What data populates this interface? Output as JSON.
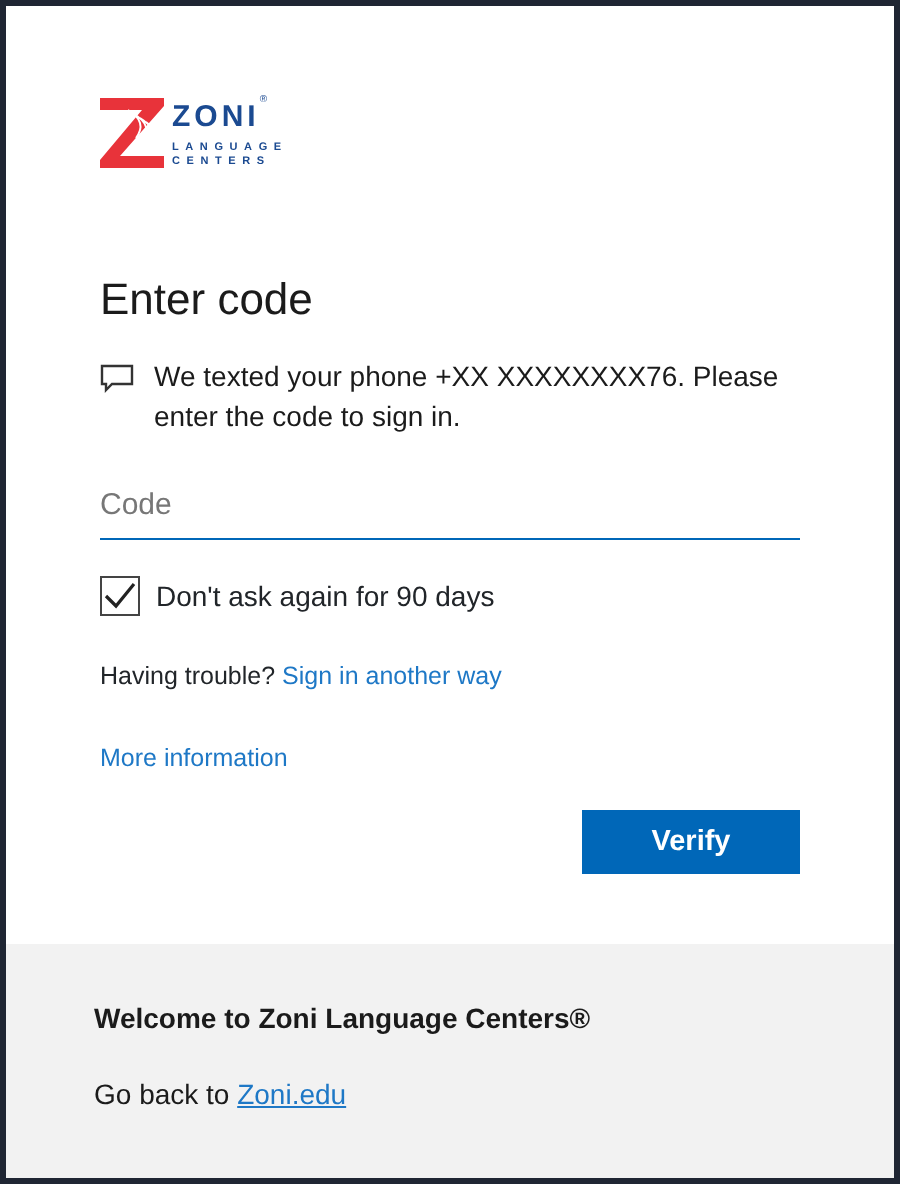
{
  "logo": {
    "name": "ZONI",
    "reg_mark": "®",
    "line_1": "LANGUAGE",
    "line_2": "CENTERS"
  },
  "heading": "Enter code",
  "message": "We texted your phone +XX XXXXXXXX76. Please enter the code to sign in.",
  "code_field": {
    "placeholder": "Code"
  },
  "remember": {
    "label": "Don't ask again for 90 days",
    "checked": true
  },
  "trouble": {
    "text": "Having trouble?",
    "link": "Sign in another way"
  },
  "more_info": "More information",
  "verify_button": "Verify",
  "footer": {
    "welcome": "Welcome to Zoni Language Centers®",
    "go_back": "Go back to",
    "link": "Zoni.edu"
  }
}
